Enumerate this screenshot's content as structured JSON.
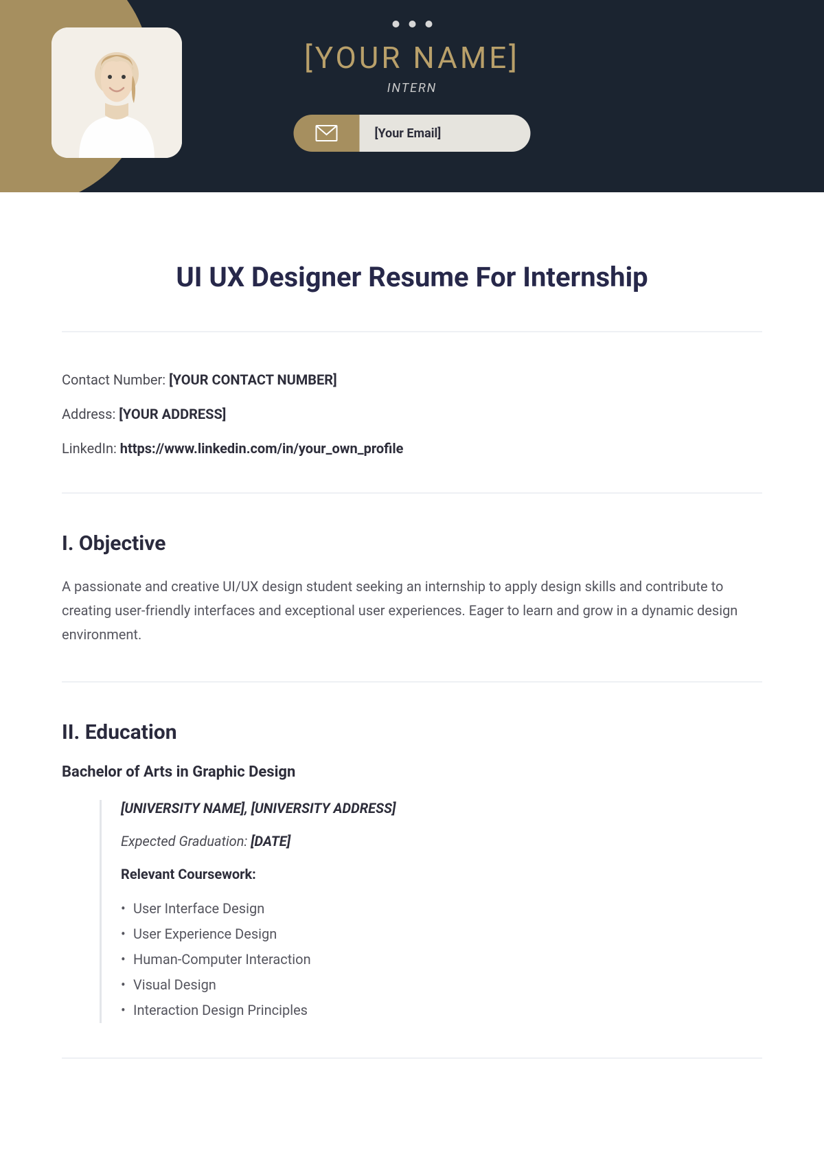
{
  "header": {
    "name": "[YOUR NAME]",
    "role": "INTERN",
    "email": "[Your Email]"
  },
  "page_title": "UI UX Designer Resume For Internship",
  "contact": {
    "phone_label": "Contact Number: ",
    "phone_value": "[YOUR CONTACT NUMBER]",
    "address_label": "Address: ",
    "address_value": "[YOUR ADDRESS]",
    "linkedin_label": "LinkedIn: ",
    "linkedin_value": "https://www.linkedin.com/in/your_own_profile"
  },
  "objective": {
    "heading": "I. Objective",
    "text": "A passionate and creative UI/UX design student seeking an internship to apply design skills and contribute to creating user-friendly interfaces and exceptional user experiences. Eager to learn and grow in a dynamic design environment."
  },
  "education": {
    "heading": "II. Education",
    "degree": "Bachelor of Arts in Graphic Design",
    "university_line": "[UNIVERSITY NAME], [UNIVERSITY ADDRESS]",
    "grad_label": "Expected Graduation: ",
    "grad_value": "[DATE]",
    "coursework_label": "Relevant Coursework:",
    "courses": [
      "User Interface Design",
      "User Experience Design",
      "Human-Computer Interaction",
      "Visual Design",
      "Interaction Design Principles"
    ]
  }
}
